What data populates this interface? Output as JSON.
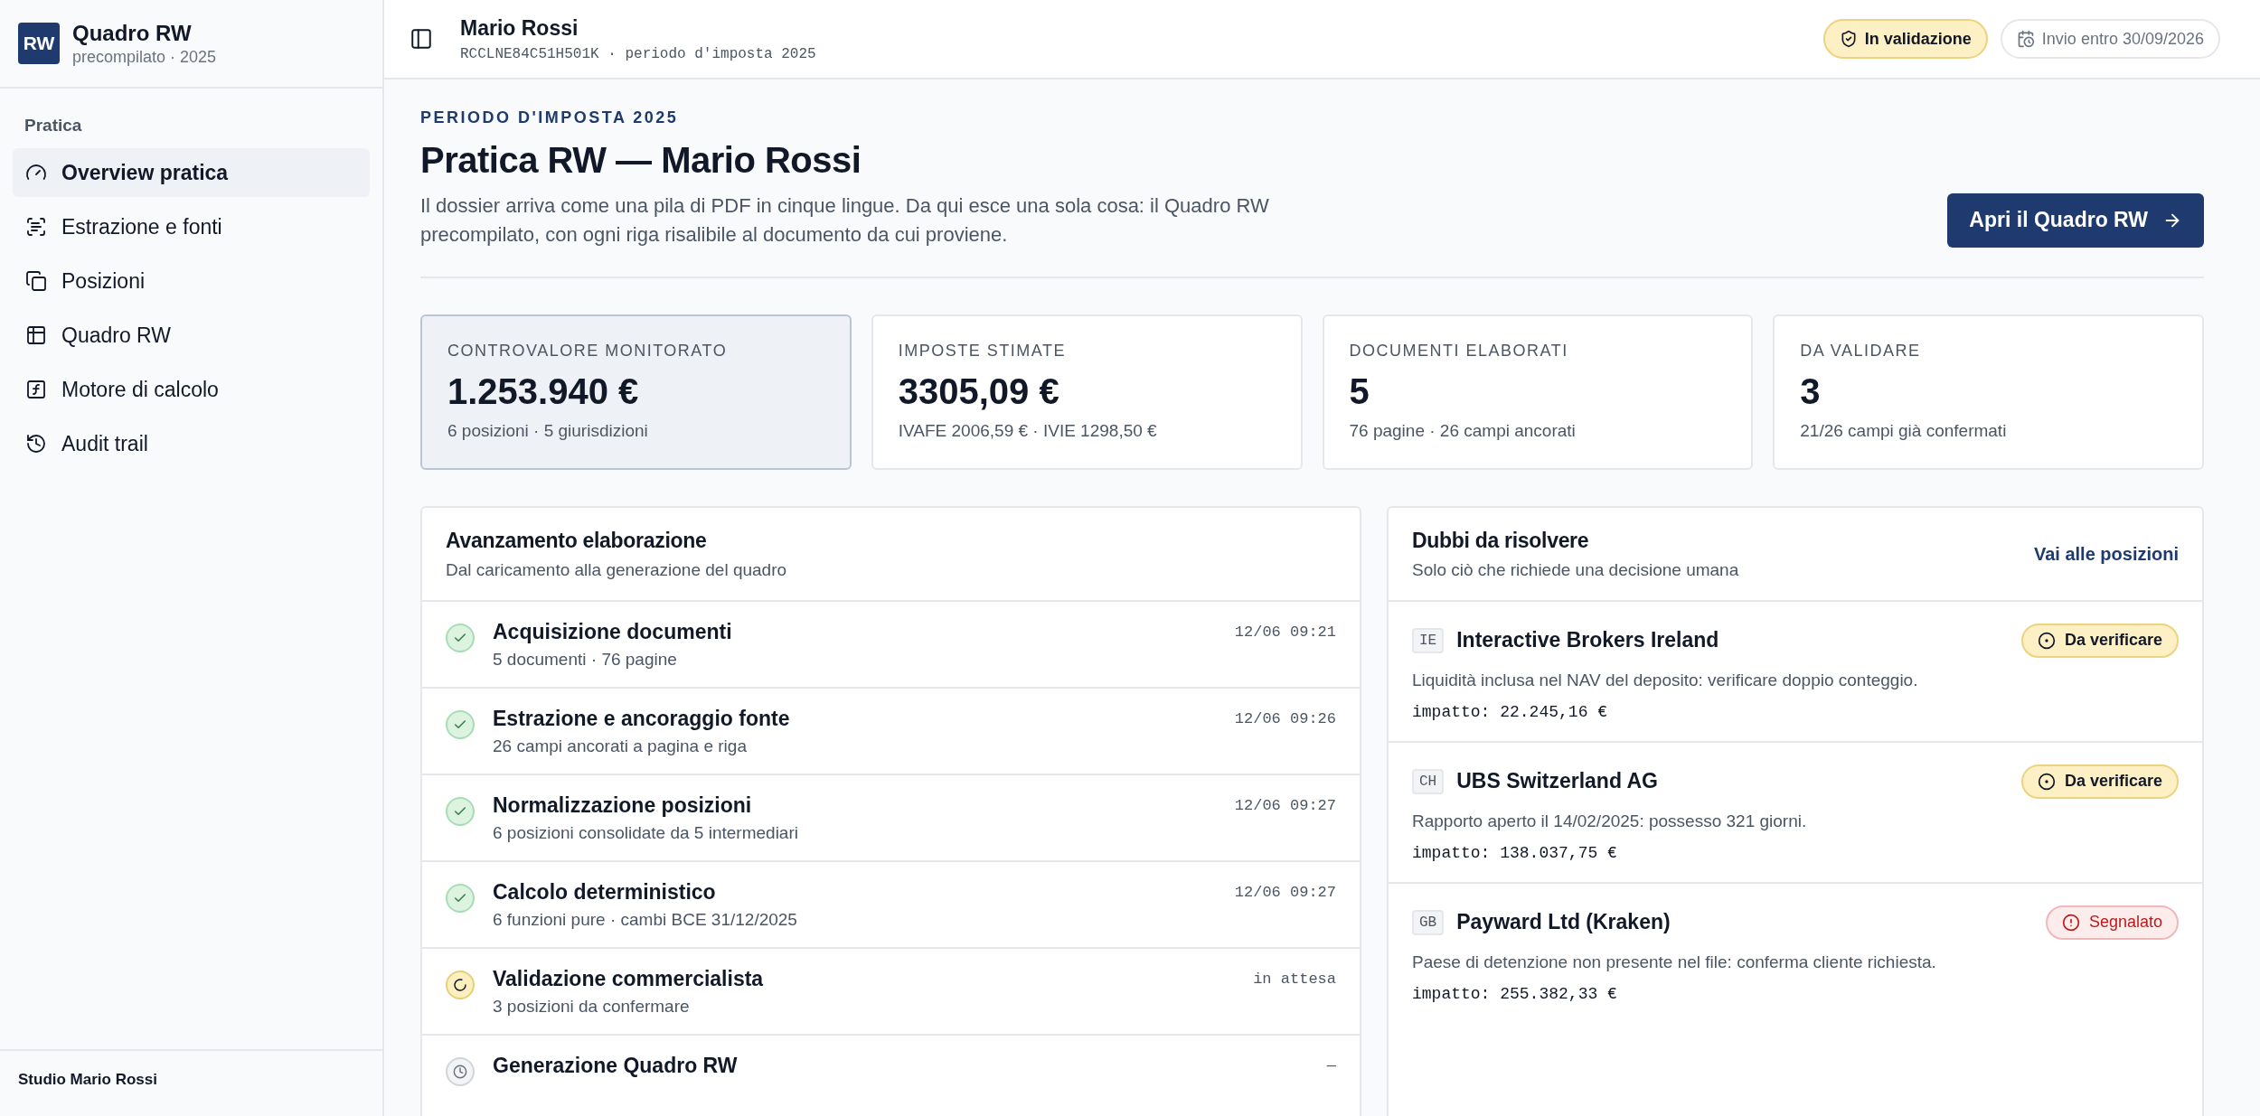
{
  "sidebar": {
    "logo": "RW",
    "title": "Quadro RW",
    "subtitle": "precompilato · 2025",
    "section": "Pratica",
    "items": [
      {
        "kind": "overview",
        "label": "Overview pratica",
        "selected": true
      },
      {
        "kind": "extraction",
        "label": "Estrazione e fonti",
        "selected": false
      },
      {
        "kind": "positions",
        "label": "Posizioni",
        "selected": false
      },
      {
        "kind": "table",
        "label": "Quadro RW",
        "selected": false
      },
      {
        "kind": "engine",
        "label": "Motore di calcolo",
        "selected": false
      },
      {
        "kind": "history",
        "label": "Audit trail",
        "selected": false
      }
    ],
    "footer": "Studio Mario Rossi"
  },
  "header": {
    "name": "Mario Rossi",
    "meta": "RCCLNE84C51H501K · periodo d'imposta 2025",
    "status_badge": "In validazione",
    "deadline_badge": "Invio entro 30/09/2026"
  },
  "intro": {
    "eyebrow": "PERIODO D'IMPOSTA 2025",
    "title": "Pratica RW — Mario Rossi",
    "description": "Il dossier arriva come una pila di PDF in cinque lingue. Da qui esce una sola cosa: il Quadro RW precompilato, con ogni riga risalibile al documento da cui proviene.",
    "button": "Apri il Quadro RW"
  },
  "stats": [
    {
      "label": "CONTROVALORE MONITORATO",
      "value": "1.253.940 €",
      "detail": "6 posizioni · 5 giurisdizioni",
      "selected": true
    },
    {
      "label": "IMPOSTE STIMATE",
      "value": "3305,09 €",
      "detail": "IVAFE 2006,59 € · IVIE 1298,50 €",
      "selected": false
    },
    {
      "label": "DOCUMENTI ELABORATI",
      "value": "5",
      "detail": "76 pagine · 26 campi ancorati",
      "selected": false
    },
    {
      "label": "DA VALIDARE",
      "value": "3",
      "detail": "21/26 campi già confermati",
      "selected": false
    }
  ],
  "progress": {
    "title": "Avanzamento elaborazione",
    "subtitle": "Dal caricamento alla generazione del quadro",
    "steps": [
      {
        "kind": "done",
        "title": "Acquisizione documenti",
        "detail": "5 documenti · 76 pagine",
        "time": "12/06 09:21"
      },
      {
        "kind": "done",
        "title": "Estrazione e ancoraggio fonte",
        "detail": "26 campi ancorati a pagina e riga",
        "time": "12/06 09:26"
      },
      {
        "kind": "done",
        "title": "Normalizzazione posizioni",
        "detail": "6 posizioni consolidate da 5 intermediari",
        "time": "12/06 09:27"
      },
      {
        "kind": "done",
        "title": "Calcolo deterministico",
        "detail": "6 funzioni pure · cambi BCE 31/12/2025",
        "time": "12/06 09:27"
      },
      {
        "kind": "running",
        "title": "Validazione commercialista",
        "detail": "3 posizioni da confermare",
        "time": "in attesa"
      },
      {
        "kind": "waiting",
        "title": "Generazione Quadro RW",
        "time": "—"
      }
    ]
  },
  "doubts": {
    "title": "Dubbi da risolvere",
    "subtitle": "Solo ciò che richiede una decisione umana",
    "link": "Vai alle posizioni",
    "items": [
      {
        "country": "IE",
        "name": "Interactive Brokers Ireland",
        "kind": "verify",
        "badge": "Da verificare",
        "note": "Liquidità inclusa nel NAV del deposito: verificare doppio conteggio.",
        "impact": "impatto: 22.245,16 €"
      },
      {
        "country": "CH",
        "name": "UBS Switzerland AG",
        "kind": "verify",
        "badge": "Da verificare",
        "note": "Rapporto aperto il 14/02/2025: possesso 321 giorni.",
        "impact": "impatto: 138.037,75 €"
      },
      {
        "country": "GB",
        "name": "Payward Ltd (Kraken)",
        "kind": "flagged",
        "badge": "Segnalato",
        "note": "Paese di detenzione non presente nel file: conferma cliente richiesta.",
        "impact": "impatto: 255.382,33 €"
      }
    ]
  }
}
